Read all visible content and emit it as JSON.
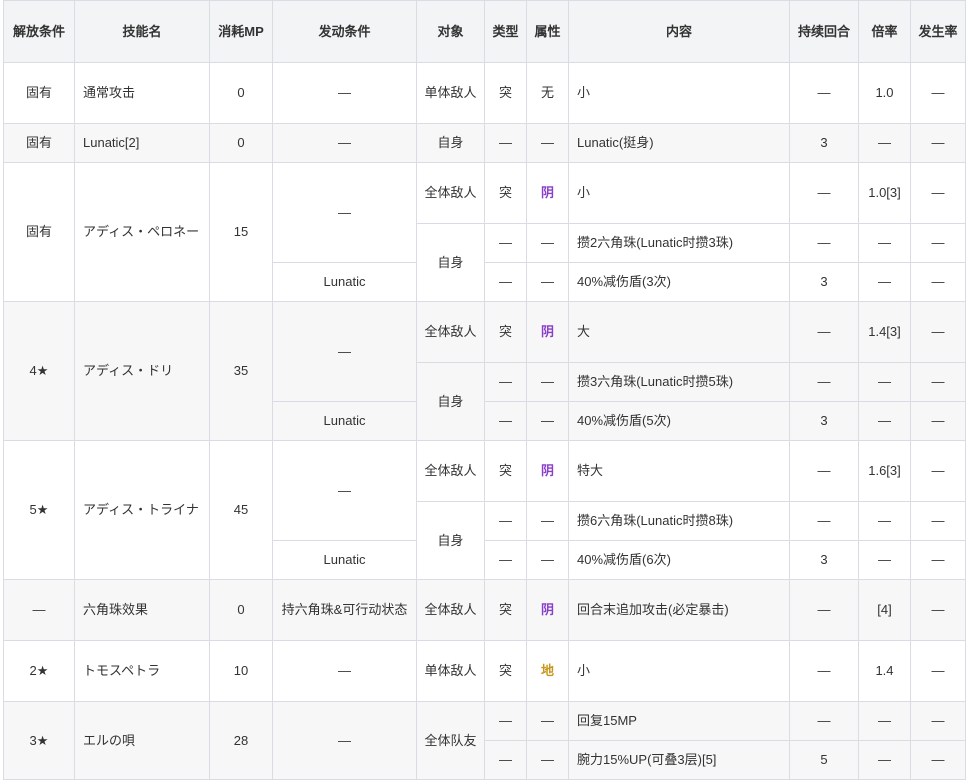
{
  "headers": [
    "解放条件",
    "技能名",
    "消耗MP",
    "发动条件",
    "对象",
    "类型",
    "属性",
    "内容",
    "持续回合",
    "倍率",
    "发生率"
  ],
  "colors": {
    "dark_attr": "#8a3fc7",
    "earth_attr": "#c8961e",
    "border": "#d9dde3",
    "header_bg": "#f3f4f6"
  },
  "rows": [
    {
      "unlock": "固有",
      "name": "通常攻击",
      "mp": "0",
      "cond": "—",
      "target": "单体敌人",
      "type": "突",
      "attr": "无",
      "content": "小",
      "turns": "—",
      "rate": "1.0",
      "occur": "—"
    },
    {
      "unlock": "固有",
      "name": "Lunatic[2]",
      "mp": "0",
      "cond": "—",
      "target": "自身",
      "type": "—",
      "attr": "—",
      "content": "Lunatic(挺身)",
      "turns": "3",
      "rate": "—",
      "occur": "—"
    },
    {
      "unlock": "固有",
      "name": "アディス・ペロネー",
      "mp": "15",
      "conds": [
        "—",
        "Lunatic"
      ],
      "targets": [
        "全体敌人",
        "自身"
      ],
      "subs": [
        {
          "type": "突",
          "attr": "阴",
          "content": "小",
          "turns": "—",
          "rate": "1.0[3]",
          "occur": "—"
        },
        {
          "type": "—",
          "attr": "—",
          "content": "攒2六角珠(Lunatic时攒3珠)",
          "turns": "—",
          "rate": "—",
          "occur": "—"
        },
        {
          "type": "—",
          "attr": "—",
          "content": "40%减伤盾(3次)",
          "turns": "3",
          "rate": "—",
          "occur": "—"
        }
      ]
    },
    {
      "unlock": "4★",
      "name": "アディス・ドリ",
      "mp": "35",
      "conds": [
        "—",
        "Lunatic"
      ],
      "targets": [
        "全体敌人",
        "自身"
      ],
      "subs": [
        {
          "type": "突",
          "attr": "阴",
          "content": "大",
          "turns": "—",
          "rate": "1.4[3]",
          "occur": "—"
        },
        {
          "type": "—",
          "attr": "—",
          "content": "攒3六角珠(Lunatic时攒5珠)",
          "turns": "—",
          "rate": "—",
          "occur": "—"
        },
        {
          "type": "—",
          "attr": "—",
          "content": "40%减伤盾(5次)",
          "turns": "3",
          "rate": "—",
          "occur": "—"
        }
      ]
    },
    {
      "unlock": "5★",
      "name": "アディス・トライナ",
      "mp": "45",
      "conds": [
        "—",
        "Lunatic"
      ],
      "targets": [
        "全体敌人",
        "自身"
      ],
      "subs": [
        {
          "type": "突",
          "attr": "阴",
          "content": "特大",
          "turns": "—",
          "rate": "1.6[3]",
          "occur": "—"
        },
        {
          "type": "—",
          "attr": "—",
          "content": "攒6六角珠(Lunatic时攒8珠)",
          "turns": "—",
          "rate": "—",
          "occur": "—"
        },
        {
          "type": "—",
          "attr": "—",
          "content": "40%减伤盾(6次)",
          "turns": "3",
          "rate": "—",
          "occur": "—"
        }
      ]
    },
    {
      "unlock": "—",
      "name": "六角珠效果",
      "mp": "0",
      "cond": "持六角珠&可行动状态",
      "target": "全体敌人",
      "type": "突",
      "attr": "阴",
      "content": "回合末追加攻击(必定暴击)",
      "turns": "—",
      "rate": "[4]",
      "occur": "—"
    },
    {
      "unlock": "2★",
      "name": "トモスペトラ",
      "mp": "10",
      "cond": "—",
      "target": "单体敌人",
      "type": "突",
      "attr": "地",
      "content": "小",
      "turns": "—",
      "rate": "1.4",
      "occur": "—"
    },
    {
      "unlock": "3★",
      "name": "エルの唄",
      "mp": "28",
      "cond": "—",
      "target": "全体队友",
      "subs": [
        {
          "type": "—",
          "attr": "—",
          "content": "回复15MP",
          "turns": "—",
          "rate": "—",
          "occur": "—"
        },
        {
          "type": "—",
          "attr": "—",
          "content": "腕力15%UP(可叠3层)[5]",
          "turns": "5",
          "rate": "—",
          "occur": "—"
        }
      ]
    }
  ]
}
